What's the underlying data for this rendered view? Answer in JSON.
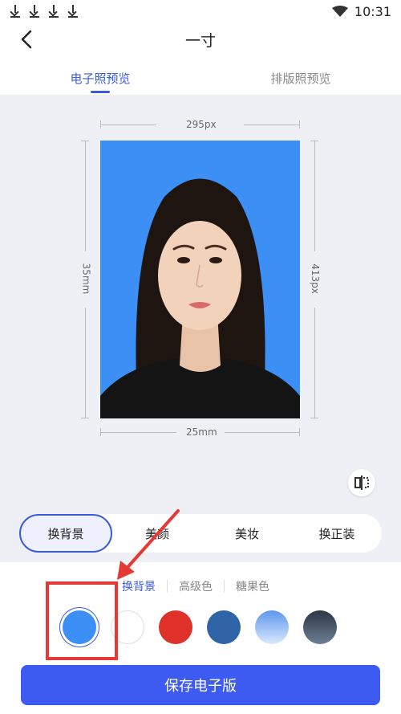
{
  "status_bar": {
    "time": "10:31",
    "download_icons": [
      "download-icon",
      "download-icon",
      "download-icon",
      "download-icon"
    ]
  },
  "header": {
    "title": "一寸"
  },
  "preview_tabs": [
    {
      "label": "电子照预览",
      "active": true
    },
    {
      "label": "排版照预览",
      "active": false
    }
  ],
  "photo": {
    "width_px_label": "295px",
    "height_px_label": "413px",
    "width_mm_label": "25mm",
    "height_mm_label": "35mm",
    "background_color": "#3b8ff5"
  },
  "tools": [
    {
      "label": "换背景",
      "active": true
    },
    {
      "label": "美颜",
      "active": false
    },
    {
      "label": "美妆",
      "active": false
    },
    {
      "label": "换正装",
      "active": false
    }
  ],
  "background_tabs": [
    {
      "label": "换背景",
      "active": true
    },
    {
      "label": "高级色",
      "active": false
    },
    {
      "label": "糖果色",
      "active": false
    }
  ],
  "swatches": [
    {
      "name": "blue",
      "color": "#3b8ff5",
      "selected": true
    },
    {
      "name": "white",
      "color": "#ffffff",
      "selected": false
    },
    {
      "name": "red",
      "color": "#e0302a",
      "selected": false
    },
    {
      "name": "dark-blue",
      "color": "#2f65a6",
      "selected": false
    },
    {
      "name": "gradient-blue",
      "color": "#8fbaf5",
      "selected": false
    },
    {
      "name": "gradient-gray",
      "color": "#3d4a5c",
      "selected": false
    }
  ],
  "save_button": {
    "label": "保存电子版"
  },
  "colors": {
    "accent": "#3d5af1",
    "highlight": "#e53935"
  }
}
